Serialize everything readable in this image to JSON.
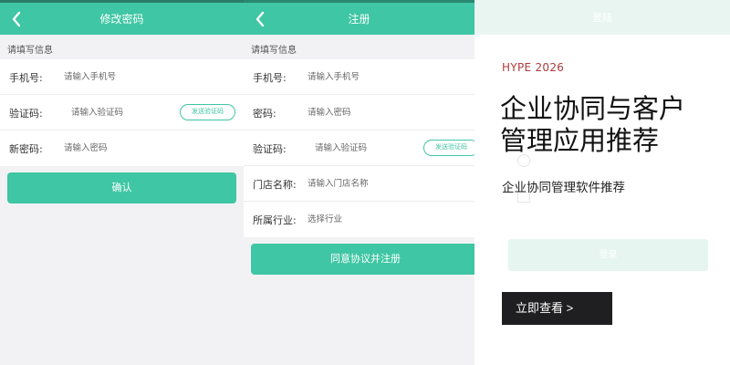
{
  "panels": {
    "change_password": {
      "title": "修改密码",
      "section_label": "请填写信息",
      "fields": [
        {
          "label": "手机号:",
          "placeholder": "请输入手机号"
        },
        {
          "label": "验证码:",
          "placeholder": "请输入验证码",
          "action": "发送验证码"
        },
        {
          "label": "新密码:",
          "placeholder": "请输入密码"
        }
      ],
      "confirm_label": "确认"
    },
    "register": {
      "title": "注册",
      "section_label": "请填写信息",
      "fields": [
        {
          "label": "手机号:",
          "placeholder": "请输入手机号"
        },
        {
          "label": "密码:",
          "placeholder": "请输入密码"
        },
        {
          "label": "验证码:",
          "placeholder": "请输入验证码",
          "action": "发送验证码"
        },
        {
          "label": "门店名称:",
          "placeholder": "请输入门店名称"
        },
        {
          "label": "所属行业:",
          "placeholder": "选择行业"
        }
      ],
      "submit_label": "同意协议并注册"
    },
    "login_overlay": {
      "title": "登陆",
      "login_button": "登录",
      "ad": {
        "tag": "HYPE 2026",
        "headline": "企业协同与客户管理应用推荐",
        "subtitle": "企业协同管理软件推荐",
        "cta": "立即查看 >"
      }
    }
  },
  "colors": {
    "brand": "#3fc6a4",
    "background": "#f2f2f4",
    "ad_tag": "#b03a3a",
    "cta_bg": "#1f1f21"
  },
  "icons": {
    "back": "chevron-left-icon",
    "user": "user-icon",
    "lock": "lock-icon"
  }
}
